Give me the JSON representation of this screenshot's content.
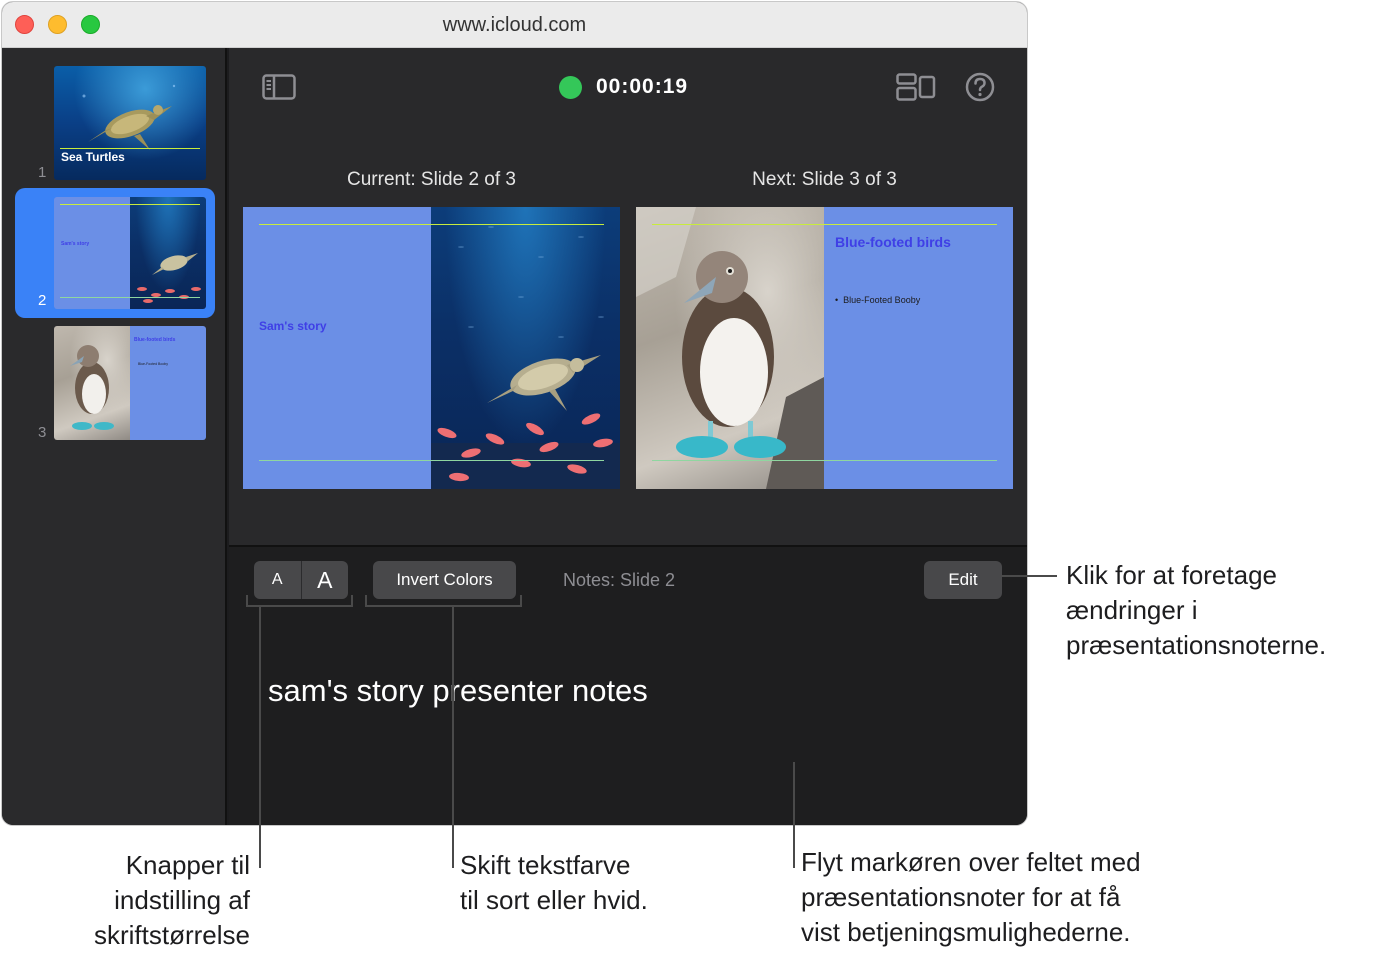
{
  "window": {
    "url": "www.icloud.com"
  },
  "navigator": {
    "slides": [
      {
        "number": "1",
        "title": "Sea Turtles"
      },
      {
        "number": "2",
        "title": "Sam's story"
      },
      {
        "number": "3",
        "title": "Blue-footed birds",
        "bullet": "Blue-Footed Booby"
      }
    ]
  },
  "toolbar": {
    "timer": "00:00:19",
    "timer_color": "#34c759"
  },
  "preview": {
    "current_caption": "Current: Slide 2 of 3",
    "next_caption": "Next: Slide 3 of 3",
    "current_slide_title": "Sam's story",
    "next_slide_title": "Blue-footed birds",
    "next_slide_bullet": "Blue-Footed Booby"
  },
  "notes": {
    "font_small_label": "A",
    "font_large_label": "A",
    "invert_label": "Invert Colors",
    "notes_label": "Notes: Slide 2",
    "edit_label": "Edit",
    "text": "sam's story presenter notes"
  },
  "callouts": {
    "edit": [
      "Klik for at foretage",
      "ændringer i",
      "præsentationsnoterne."
    ],
    "font_size": [
      "Knapper til",
      "indstilling af",
      "skriftstørrelse"
    ],
    "invert": [
      "Skift tekstfarve",
      "til sort eller hvid."
    ],
    "notes_field": [
      "Flyt markøren over feltet med",
      "præsentationsnoter for at få",
      "vist betjeningsmulighederne."
    ]
  },
  "colors": {
    "selection": "#3a82f7",
    "slide_panel": "#6b8fe6",
    "slide_title": "#3f3fe6",
    "guide_green": "#c8ec3c"
  }
}
